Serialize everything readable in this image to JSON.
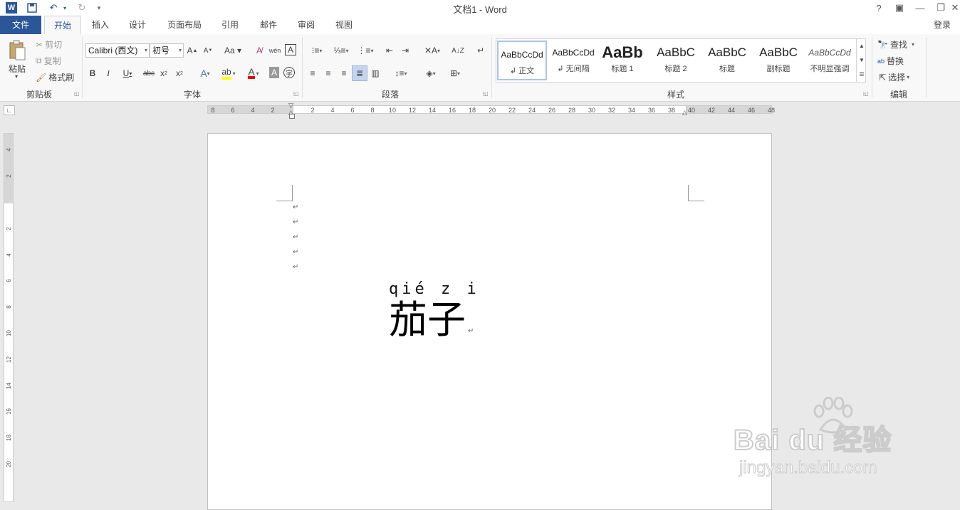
{
  "window": {
    "title": "文档1 - Word"
  },
  "quick_access": {
    "icons": [
      "word-logo-icon",
      "save-icon",
      "undo-icon",
      "redo-icon",
      "customize-icon"
    ]
  },
  "window_controls": {
    "help": "?",
    "ribbon_display": "▣",
    "minimize": "—",
    "restore": "❐",
    "close": "✕"
  },
  "tabs": [
    {
      "label": "文件"
    },
    {
      "label": "开始"
    },
    {
      "label": "插入"
    },
    {
      "label": "设计"
    },
    {
      "label": "页面布局"
    },
    {
      "label": "引用"
    },
    {
      "label": "邮件"
    },
    {
      "label": "审阅"
    },
    {
      "label": "视图"
    }
  ],
  "signin": "登录",
  "ribbon": {
    "clipboard": {
      "label": "剪贴板",
      "paste": "粘贴",
      "cut": "剪切",
      "copy": "复制",
      "format_painter": "格式刷"
    },
    "font": {
      "label": "字体",
      "font_name": "Calibri (西文)",
      "font_size": "初号"
    },
    "paragraph": {
      "label": "段落"
    },
    "styles": {
      "label": "样式",
      "items": [
        {
          "sample": "AaBbCcDd",
          "name": "↲ 正文"
        },
        {
          "sample": "AaBbCcDd",
          "name": "↲ 无间隔"
        },
        {
          "sample": "AaBb",
          "name": "标题 1"
        },
        {
          "sample": "AaBbC",
          "name": "标题 2"
        },
        {
          "sample": "AaBbC",
          "name": "标题"
        },
        {
          "sample": "AaBbC",
          "name": "副标题"
        },
        {
          "sample": "AaBbCcDd",
          "name": "不明显强调"
        }
      ]
    },
    "editing": {
      "label": "编辑",
      "find": "查找",
      "replace": "替换",
      "select": "选择"
    }
  },
  "ruler": {
    "h_left": [
      "8",
      "6",
      "4",
      "2"
    ],
    "h_right": [
      "2",
      "4",
      "6",
      "8",
      "10",
      "12",
      "14",
      "16",
      "18",
      "20",
      "22",
      "24",
      "26",
      "28",
      "30",
      "32",
      "34",
      "36",
      "38",
      "40",
      "42",
      "44",
      "46",
      "48"
    ],
    "v_top": [
      "4",
      "2"
    ],
    "v_bottom": [
      "2",
      "4",
      "6",
      "8",
      "10",
      "12",
      "14",
      "16",
      "18",
      "20"
    ]
  },
  "document": {
    "pinyin": "qié z i",
    "text": "茄子",
    "paragraph_mark": "↵"
  },
  "watermark": {
    "brand": "Bai du 经验",
    "url": "jingyan.baidu.com"
  }
}
